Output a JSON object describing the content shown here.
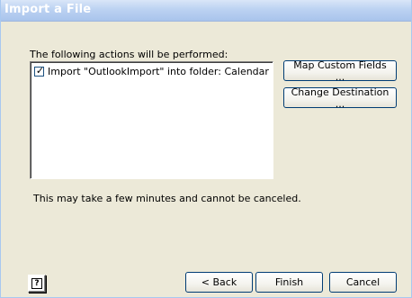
{
  "window": {
    "title": "Import a File"
  },
  "header": {
    "text": "The following actions will be performed:"
  },
  "actions": [
    {
      "label": "Import \"OutlookImport\" into folder: Calendar",
      "checked": true
    }
  ],
  "side_buttons": {
    "map_fields": "Map Custom Fields ...",
    "change_destination": "Change Destination ..."
  },
  "notice": "This may take a few minutes and cannot be canceled.",
  "help": {
    "glyph": "?",
    "icon": "help-icon"
  },
  "footer": {
    "back": "< Back",
    "finish": "Finish",
    "cancel": "Cancel"
  }
}
